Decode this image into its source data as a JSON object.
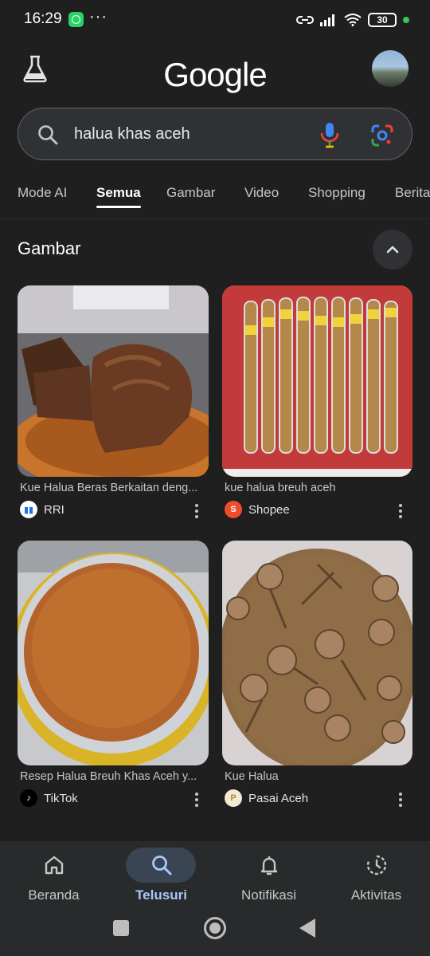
{
  "status_bar": {
    "time": "16:29",
    "battery": "30",
    "more": "···"
  },
  "header": {
    "logo": "Google",
    "lab_icon": "flask-icon",
    "avatar_icon": "avatar"
  },
  "search": {
    "query": "halua khas aceh",
    "icons": [
      "search-icon",
      "mic-icon",
      "lens-icon"
    ]
  },
  "tabs": [
    "Mode AI",
    "Semua",
    "Gambar",
    "Video",
    "Shopping",
    "Berita"
  ],
  "active_tab": "Semua",
  "section": {
    "title": "Gambar"
  },
  "images": [
    {
      "caption": "Kue Halua Beras Berkaitan deng...",
      "source": "RRI",
      "source_icon": "rri-logo"
    },
    {
      "caption": "kue halua breuh aceh",
      "source": "Shopee",
      "source_icon": "shopee-logo"
    },
    {
      "caption": "Resep Halua Breuh Khas Aceh y...",
      "source": "TikTok",
      "source_icon": "tiktok-logo"
    },
    {
      "caption": "Kue Halua",
      "source": "Pasai Aceh",
      "source_icon": "pasai-logo"
    }
  ],
  "bottom_nav": [
    {
      "label": "Beranda",
      "icon": "home-icon"
    },
    {
      "label": "Telusuri",
      "icon": "search-icon"
    },
    {
      "label": "Notifikasi",
      "icon": "bell-icon"
    },
    {
      "label": "Aktivitas",
      "icon": "history-icon"
    }
  ],
  "active_nav": "Telusuri",
  "colors": {
    "background": "#1f1f1f",
    "accent": "#a8c7fa",
    "search_bg": "#303134"
  }
}
